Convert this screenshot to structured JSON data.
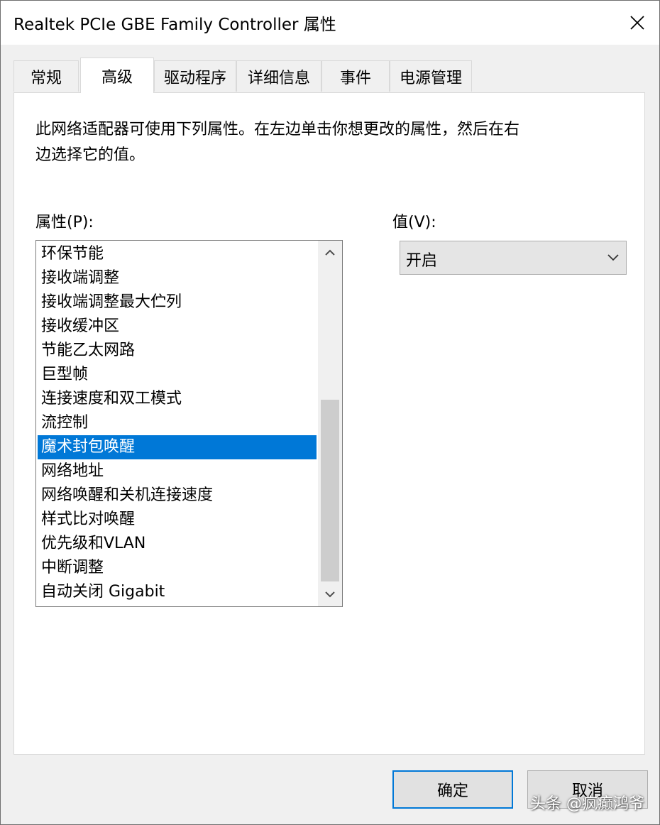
{
  "window": {
    "title": "Realtek PCIe GBE Family Controller 属性"
  },
  "tabs": [
    {
      "label": "常规",
      "active": false
    },
    {
      "label": "高级",
      "active": true
    },
    {
      "label": "驱动程序",
      "active": false
    },
    {
      "label": "详细信息",
      "active": false
    },
    {
      "label": "事件",
      "active": false
    },
    {
      "label": "电源管理",
      "active": false
    }
  ],
  "advanced": {
    "description_line1": "此网络适配器可使用下列属性。在左边单击你想更改的属性，然后在右",
    "description_line2": "边选择它的值。",
    "property_label": "属性(P):",
    "value_label": "值(V):",
    "properties": [
      "环保节能",
      "接收端调整",
      "接收端调整最大伫列",
      "接收缓冲区",
      "节能乙太网路",
      "巨型帧",
      "连接速度和双工模式",
      "流控制",
      "魔术封包唤醒",
      "网络地址",
      "网络唤醒和关机连接速度",
      "样式比对唤醒",
      "优先级和VLAN",
      "中断调整",
      "自动关闭 Gigabit"
    ],
    "selected_property": "魔术封包唤醒",
    "selected_value": "开启"
  },
  "buttons": {
    "ok": "确定",
    "cancel": "取消"
  },
  "watermark": "头条 @疯癫鸿爷",
  "colors": {
    "selection": "#0078d7",
    "default_button_border": "#0078d7"
  },
  "scrollbar": {
    "position_fraction": 0.72
  }
}
